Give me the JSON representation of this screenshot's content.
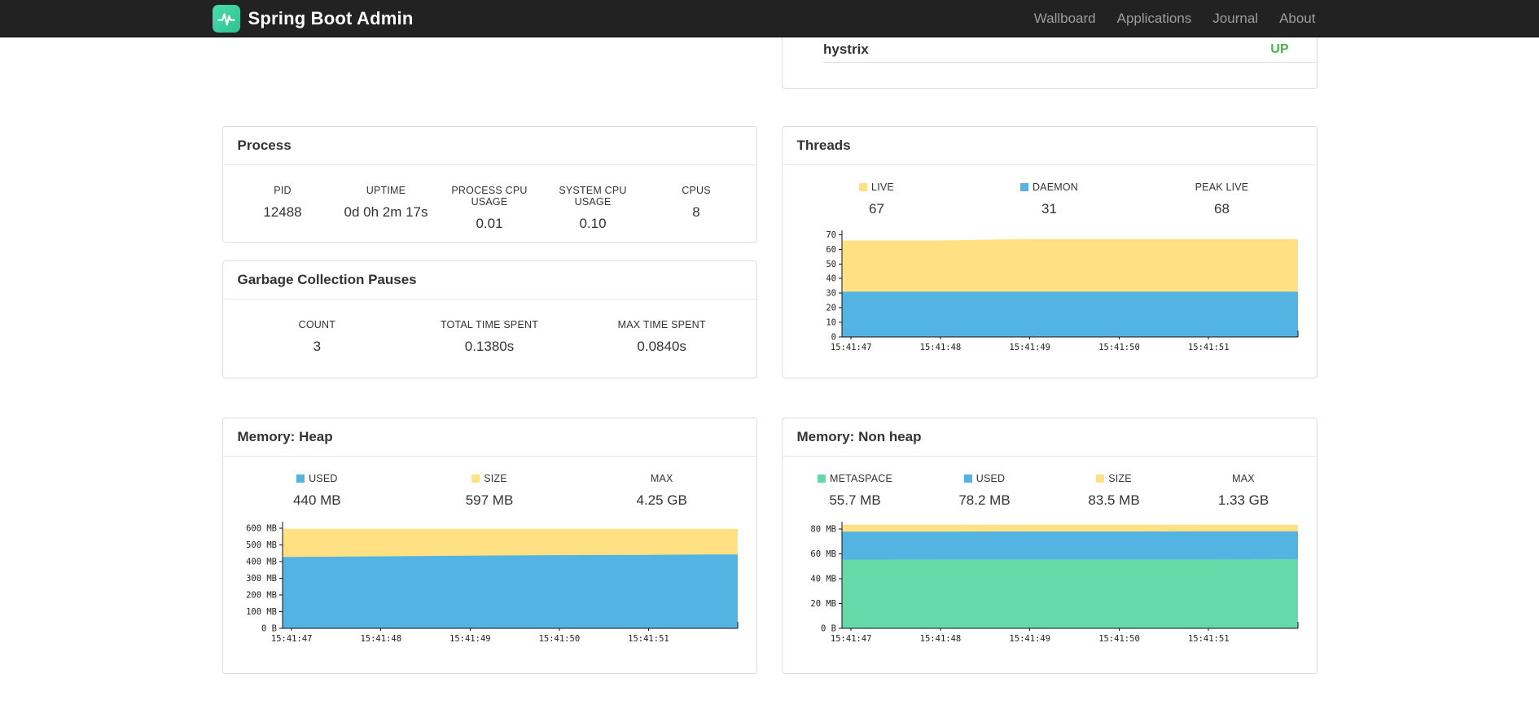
{
  "navbar": {
    "brand": "Spring Boot Admin",
    "links": [
      {
        "label": "Wallboard"
      },
      {
        "label": "Applications"
      },
      {
        "label": "Journal"
      },
      {
        "label": "About"
      }
    ]
  },
  "colors": {
    "navbar_bg": "#222222",
    "brand_teal": "#41d6a3",
    "status_up": "#45b649",
    "series_blue": "#53b3e3",
    "series_yellow": "#ffe082",
    "series_green": "#66d9a8"
  },
  "application": {
    "name": "hystrix",
    "status": "UP"
  },
  "process": {
    "title": "Process",
    "stats": [
      {
        "label": "PID",
        "value": "12488"
      },
      {
        "label": "UPTIME",
        "value": "0d 0h 2m 17s"
      },
      {
        "label": "PROCESS CPU USAGE",
        "value": "0.01"
      },
      {
        "label": "SYSTEM CPU USAGE",
        "value": "0.10"
      },
      {
        "label": "CPUS",
        "value": "8"
      }
    ]
  },
  "gc": {
    "title": "Garbage Collection Pauses",
    "stats": [
      {
        "label": "COUNT",
        "value": "3"
      },
      {
        "label": "TOTAL TIME SPENT",
        "value": "0.1380s"
      },
      {
        "label": "MAX TIME SPENT",
        "value": "0.0840s"
      }
    ]
  },
  "threads": {
    "title": "Threads",
    "legend": [
      {
        "label": "LIVE",
        "value": "67",
        "color": "#ffe082"
      },
      {
        "label": "DAEMON",
        "value": "31",
        "color": "#53b3e3"
      },
      {
        "label": "PEAK LIVE",
        "value": "68"
      }
    ]
  },
  "memory_heap": {
    "title": "Memory: Heap",
    "legend": [
      {
        "label": "USED",
        "value": "440 MB",
        "color": "#53b3e3"
      },
      {
        "label": "SIZE",
        "value": "597 MB",
        "color": "#ffe082"
      },
      {
        "label": "MAX",
        "value": "4.25 GB"
      }
    ]
  },
  "memory_nonheap": {
    "title": "Memory: Non heap",
    "legend": [
      {
        "label": "METASPACE",
        "value": "55.7 MB",
        "color": "#66d9a8"
      },
      {
        "label": "USED",
        "value": "78.2 MB",
        "color": "#53b3e3"
      },
      {
        "label": "SIZE",
        "value": "83.5 MB",
        "color": "#ffe082"
      },
      {
        "label": "MAX",
        "value": "1.33 GB"
      }
    ]
  },
  "chart_data": [
    {
      "type": "area",
      "title": "Threads",
      "legend_position": "top",
      "grid": false,
      "x_ticks": [
        "15:41:47",
        "15:41:48",
        "15:41:49",
        "15:41:50",
        "15:41:51"
      ],
      "ylim": [
        0,
        73
      ],
      "y_ticks": [
        {
          "v": 70,
          "label": "70"
        },
        {
          "v": 60,
          "label": "60"
        },
        {
          "v": 50,
          "label": "50"
        },
        {
          "v": 40,
          "label": "40"
        },
        {
          "v": 30,
          "label": "30"
        },
        {
          "v": 20,
          "label": "20"
        },
        {
          "v": 10,
          "label": "10"
        },
        {
          "v": 0,
          "label": "0"
        }
      ],
      "series": [
        {
          "name": "LIVE",
          "color": "#ffe082",
          "values": [
            66,
            66,
            67,
            67,
            67,
            67
          ]
        },
        {
          "name": "DAEMON",
          "color": "#53b3e3",
          "values": [
            31,
            31,
            31,
            31,
            31,
            31
          ]
        }
      ]
    },
    {
      "type": "area",
      "title": "Memory: Heap (MB)",
      "legend_position": "top",
      "grid": false,
      "x_ticks": [
        "15:41:47",
        "15:41:48",
        "15:41:49",
        "15:41:50",
        "15:41:51"
      ],
      "ylim": [
        0,
        640
      ],
      "y_ticks": [
        {
          "v": 600,
          "label": "600 MB"
        },
        {
          "v": 500,
          "label": "500 MB"
        },
        {
          "v": 400,
          "label": "400 MB"
        },
        {
          "v": 300,
          "label": "300 MB"
        },
        {
          "v": 200,
          "label": "200 MB"
        },
        {
          "v": 100,
          "label": "100 MB"
        },
        {
          "v": 0,
          "label": "0 B"
        }
      ],
      "series": [
        {
          "name": "SIZE",
          "color": "#ffe082",
          "values": [
            597,
            597,
            597,
            597,
            597,
            597
          ]
        },
        {
          "name": "USED",
          "color": "#53b3e3",
          "values": [
            428,
            432,
            436,
            439,
            441,
            444
          ]
        }
      ]
    },
    {
      "type": "area",
      "title": "Memory: Non heap (MB)",
      "legend_position": "top",
      "grid": false,
      "x_ticks": [
        "15:41:47",
        "15:41:48",
        "15:41:49",
        "15:41:50",
        "15:41:51"
      ],
      "ylim": [
        0,
        86
      ],
      "y_ticks": [
        {
          "v": 80,
          "label": "80 MB"
        },
        {
          "v": 60,
          "label": "60 MB"
        },
        {
          "v": 40,
          "label": "40 MB"
        },
        {
          "v": 20,
          "label": "20 MB"
        },
        {
          "v": 0,
          "label": "0 B"
        }
      ],
      "series": [
        {
          "name": "SIZE",
          "color": "#ffe082",
          "values": [
            83.5,
            83.5,
            83.5,
            83.5,
            83.5,
            83.5
          ]
        },
        {
          "name": "USED",
          "color": "#53b3e3",
          "values": [
            78.0,
            78.0,
            78.1,
            78.1,
            78.2,
            78.2
          ]
        },
        {
          "name": "METASPACE",
          "color": "#66d9a8",
          "values": [
            55.5,
            55.6,
            55.6,
            55.7,
            55.7,
            55.8
          ]
        }
      ]
    }
  ]
}
